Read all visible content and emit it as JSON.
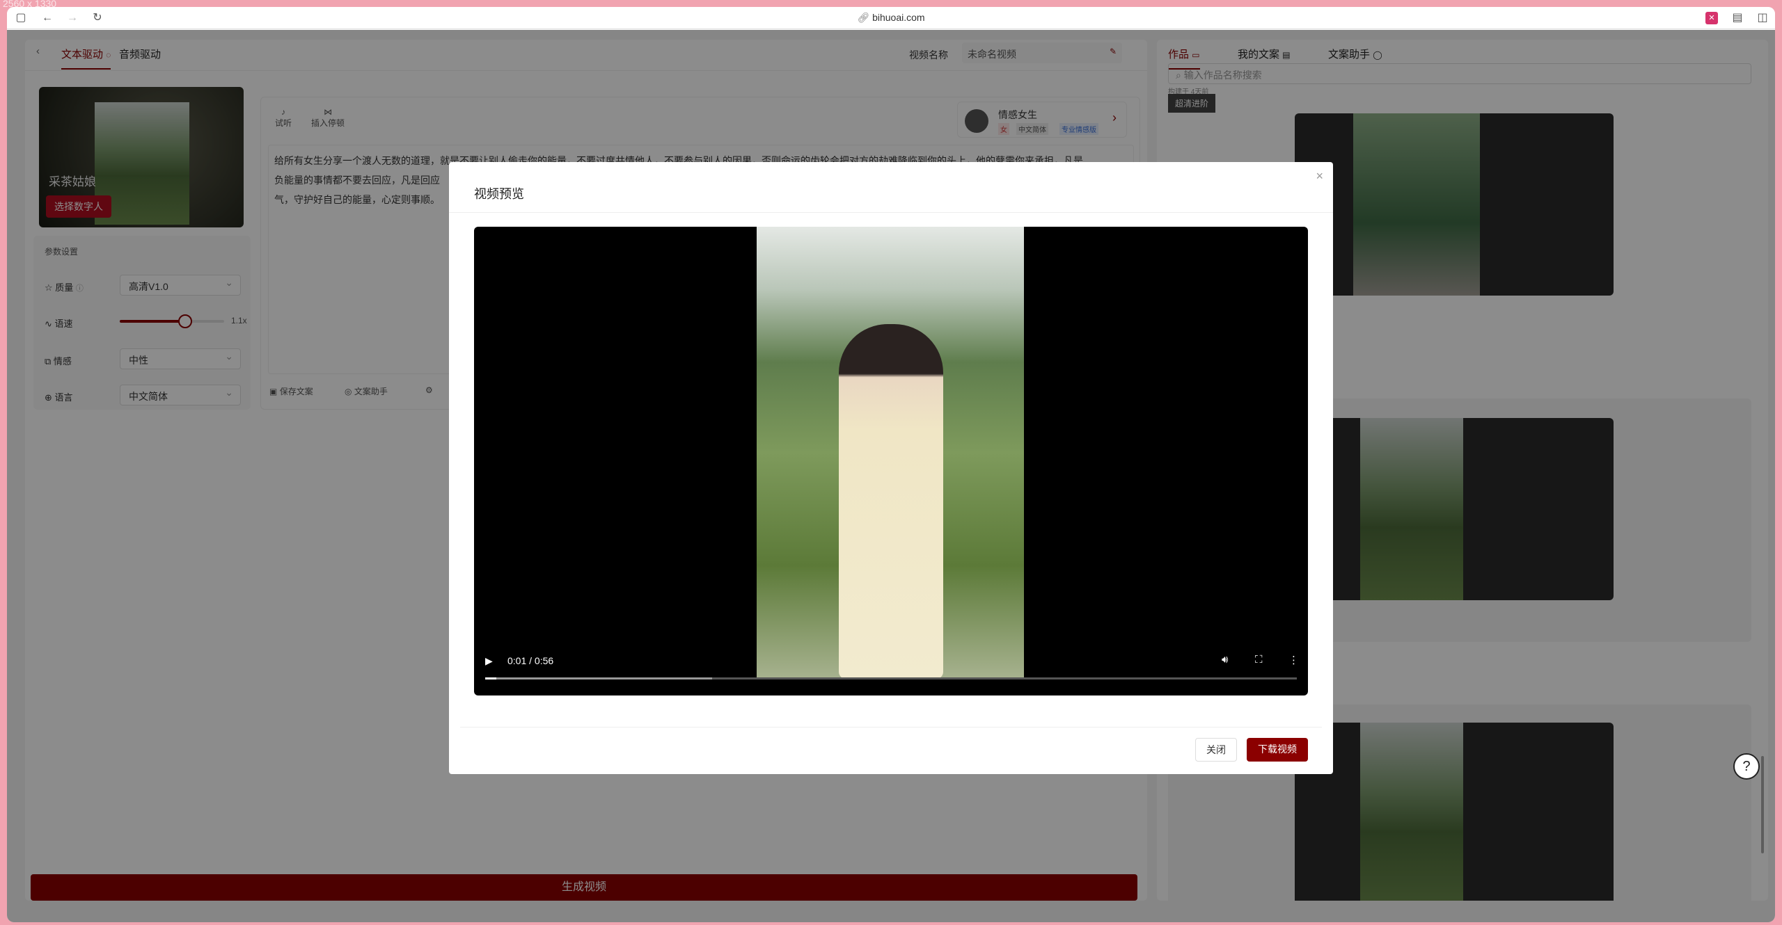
{
  "size_label": "2560 x 1330",
  "browser": {
    "url": "bihuoai.com"
  },
  "left": {
    "tabs": [
      "文本驱动",
      "音频驱动"
    ],
    "video_name_label": "视频名称",
    "video_name_value": "未命名视频",
    "avatar_name": "采茶姑娘",
    "select_avatar": "选择数字人",
    "params_title": "参数设置",
    "quality_label": "质量",
    "quality_value": "高清V1.0",
    "speed_label": "语速",
    "speed_value": "1.1x",
    "emotion_label": "情感",
    "emotion_value": "中性",
    "language_label": "语言",
    "language_value": "中文简体",
    "tool_listen": "试听",
    "tool_pause": "插入停顿",
    "voice_name": "情感女生",
    "voice_tags": [
      "女",
      "中文简体",
      "专业情感版"
    ],
    "script_line1": "给所有女生分享一个渡人无数的道理，就是不要让别人偷走你的能量，不要过度共情他人，不要参与别人的因果，否则命运的齿轮会把对方的劫难降临到你的头上，他的孽需你来承担，凡是",
    "script_line2": "负能量的事情都不要去回应，凡是回应",
    "script_line3": "气，守护好自己的能量，心定则事顺。",
    "save_script": "保存文案",
    "script_assistant": "文案助手",
    "generate": "生成视频"
  },
  "right": {
    "tabs": [
      "作品",
      "我的文案",
      "文案助手"
    ],
    "search_placeholder": "输入作品名称搜索",
    "meta": "构建于 4天前",
    "badge": "超清进阶"
  },
  "modal": {
    "title": "视频预览",
    "time": "0:01 / 0:56",
    "progress": 0.014,
    "buffered": 0.28,
    "close": "关闭",
    "download": "下载视频"
  }
}
